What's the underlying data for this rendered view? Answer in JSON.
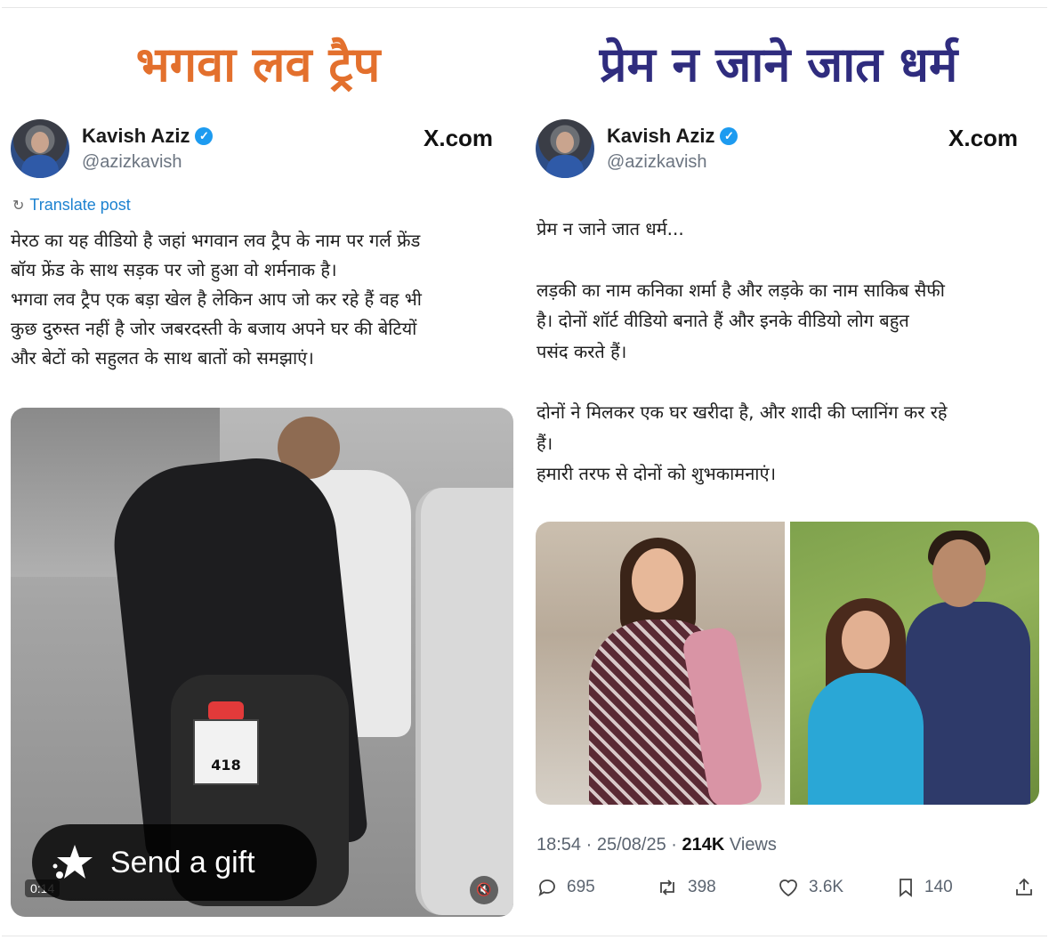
{
  "headlines": {
    "left": "भगवा लव ट्रैप",
    "right": "प्रेम न जाने जात धर्म",
    "left_color": "#e3702d",
    "right_color": "#2f2c7e"
  },
  "left_post": {
    "author_name": "Kavish Aziz",
    "author_handle": "@azizkavish",
    "source": "X.com",
    "translate_label": "Translate post",
    "text_lines": [
      "मेरठ का यह वीडियो है जहां भगवान लव ट्रैप के नाम पर गर्ल फ्रेंड",
      "बॉय फ्रेंड के साथ सड़क पर जो हुआ वो शर्मनाक है।",
      "भगवा लव ट्रैप एक बड़ा खेल है लेकिन आप जो कर रहे हैं वह भी",
      "कुछ दुरुस्त नहीं है जोर जबरदस्ती के बजाय अपने घर की बेटियों",
      "और बेटों को सहुलत के साथ बातों को समझाएं।"
    ],
    "video": {
      "timestamp": "0:14",
      "plate": "418"
    }
  },
  "right_post": {
    "author_name": "Kavish Aziz",
    "author_handle": "@azizkavish",
    "source": "X.com",
    "text_lines": [
      "प्रेम न जाने जात धर्म...",
      "",
      "लड़की का नाम कनिका शर्मा है और लड़के का नाम साकिब सैफी",
      "है। दोनों शॉर्ट वीडियो बनाते हैं और इनके वीडियो लोग बहुत",
      "पसंद करते हैं।",
      "",
      "दोनों ने मिलकर एक घर खरीदा है, और शादी की प्लानिंग कर रहे",
      "हैं।",
      "हमारी तरफ से दोनों को शुभकामनाएं।"
    ],
    "meta": {
      "time": "18:54",
      "date": "25/08/25",
      "views_count": "214K",
      "views_label": "Views"
    },
    "actions": {
      "replies": "695",
      "reposts": "398",
      "likes": "3.6K",
      "bookmarks": "140"
    }
  },
  "gift_button": {
    "label": "Send a gift"
  },
  "icons": {
    "verified": "verified-badge-icon",
    "translate": "translate-icon",
    "reply": "reply-icon",
    "repost": "repost-icon",
    "like": "heart-icon",
    "bookmark": "bookmark-icon",
    "share": "share-icon",
    "gift": "gift-star-icon",
    "mute": "mute-icon"
  },
  "colors": {
    "verified_blue": "#1d9bf0",
    "link_blue": "#1d82d0",
    "muted_text": "#5b6470"
  }
}
